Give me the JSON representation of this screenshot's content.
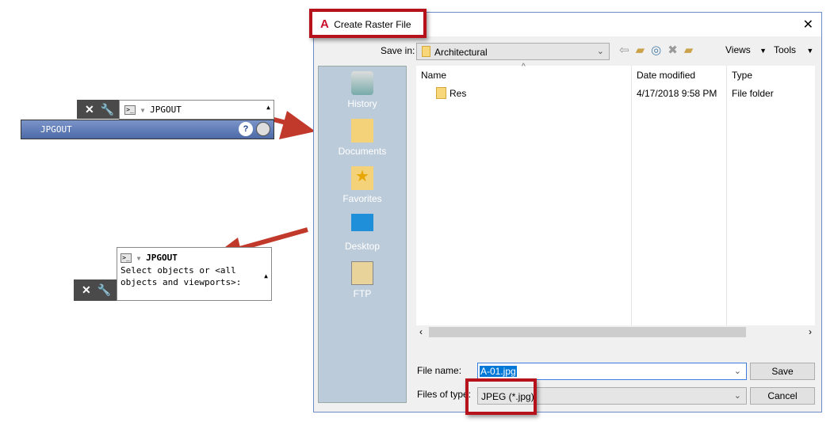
{
  "top_cmd": {
    "command": "JPGOUT",
    "bar_label": "JPGOUT"
  },
  "bottom_cmd": {
    "command": "JPGOUT",
    "line1": "Select objects or <all",
    "line2": "objects and viewports>:"
  },
  "dialog": {
    "title": "Create Raster File",
    "save_in_label": "Save in:",
    "save_in_value": "Architectural",
    "views_label": "Views",
    "tools_label": "Tools",
    "places": [
      {
        "label": "History"
      },
      {
        "label": "Documents"
      },
      {
        "label": "Favorites"
      },
      {
        "label": "Desktop"
      },
      {
        "label": "FTP"
      }
    ],
    "columns": [
      "Name",
      "Date modified",
      "Type"
    ],
    "rows": [
      {
        "name": "Res",
        "date": "4/17/2018 9:58 PM",
        "type": "File folder"
      }
    ],
    "file_name_label": "File name:",
    "file_name_value": "A-01.jpg",
    "files_of_type_label": "Files of type:",
    "files_of_type_value": "JPEG (*.jpg)",
    "save_label": "Save",
    "cancel_label": "Cancel"
  },
  "colors": {
    "highlight": "#b5121b",
    "arrow": "#c0392b",
    "cmd_bar": "#5b78b4"
  }
}
